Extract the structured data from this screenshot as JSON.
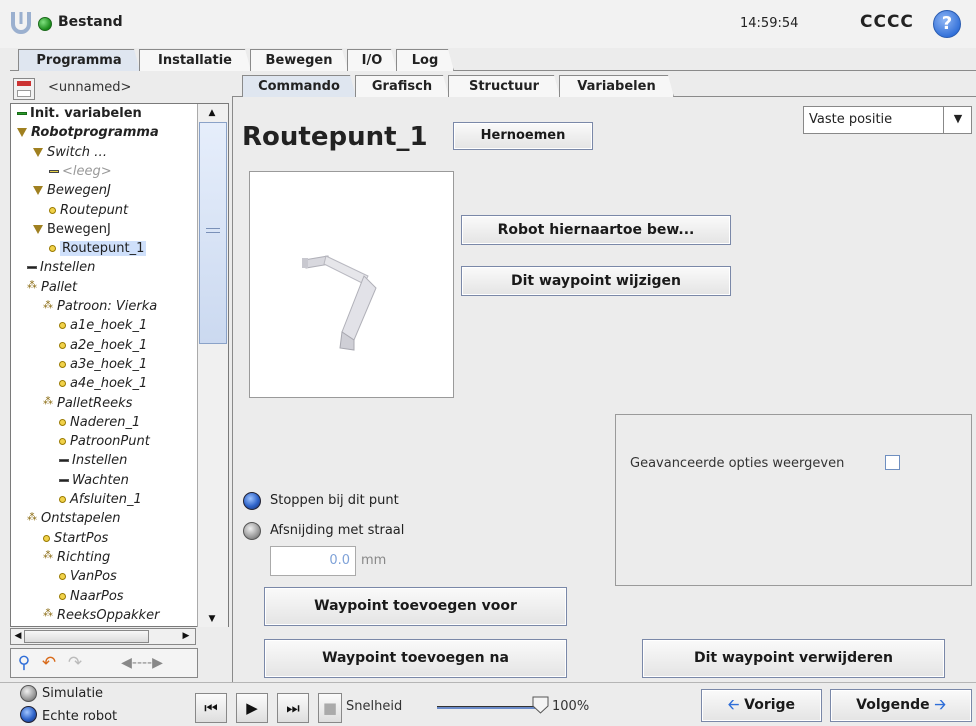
{
  "header": {
    "title": "Bestand",
    "clock": "14:59:54",
    "user": "CCCC",
    "help_icon": "?"
  },
  "main_tabs": [
    "Programma",
    "Installatie",
    "Bewegen",
    "I/O",
    "Log"
  ],
  "program_name": "<unnamed>",
  "sub_tabs": [
    "Commando",
    "Grafisch",
    "Structuur",
    "Variabelen"
  ],
  "tree": [
    {
      "label": "Init. variabelen",
      "icon": "green-bar-icon"
    },
    {
      "label": "Robotprogramma",
      "icon": "triangle-icon"
    },
    {
      "label": "Switch …",
      "icon": "triangle-icon"
    },
    {
      "label": "<leeg>",
      "icon": "yellow-bar-icon"
    },
    {
      "label": "BewegenJ",
      "icon": "triangle-icon"
    },
    {
      "label": "Routepunt",
      "icon": "waypoint-icon"
    },
    {
      "label": "BewegenJ",
      "icon": "triangle-icon"
    },
    {
      "label": "Routepunt_1",
      "icon": "waypoint-icon"
    },
    {
      "label": "Instellen",
      "icon": "bar-icon"
    },
    {
      "label": "Pallet",
      "icon": "pallet-icon"
    },
    {
      "label": "Patroon: Vierka",
      "icon": "pallet-icon"
    },
    {
      "label": "a1e_hoek_1",
      "icon": "waypoint-icon"
    },
    {
      "label": "a2e_hoek_1",
      "icon": "waypoint-icon"
    },
    {
      "label": "a3e_hoek_1",
      "icon": "waypoint-icon"
    },
    {
      "label": "a4e_hoek_1",
      "icon": "waypoint-icon"
    },
    {
      "label": "PalletReeks",
      "icon": "pallet-icon"
    },
    {
      "label": "Naderen_1",
      "icon": "waypoint-icon"
    },
    {
      "label": "PatroonPunt",
      "icon": "waypoint-icon"
    },
    {
      "label": "Instellen",
      "icon": "bar-icon"
    },
    {
      "label": "Wachten",
      "icon": "bar-icon"
    },
    {
      "label": "Afsluiten_1",
      "icon": "waypoint-icon"
    },
    {
      "label": "Ontstapelen",
      "icon": "pallet-icon"
    },
    {
      "label": "StartPos",
      "icon": "waypoint-icon"
    },
    {
      "label": "Richting",
      "icon": "pallet-icon"
    },
    {
      "label": "VanPos",
      "icon": "waypoint-icon"
    },
    {
      "label": "NaarPos",
      "icon": "waypoint-icon"
    },
    {
      "label": "ReeksOppakker",
      "icon": "pallet-icon"
    }
  ],
  "command": {
    "waypoint_name": "Routepunt_1",
    "rename_label": "Hernoemen",
    "position_type": "Vaste positie",
    "move_here_label": "Robot hiernaartoe bew...",
    "change_waypoint_label": "Dit waypoint wijzigen",
    "advanced_label": "Geavanceerde opties weergeven",
    "stop_label": "Stoppen bij dit punt",
    "blend_label": "Afsnijding met straal",
    "blend_value": "0.0",
    "blend_unit": "mm",
    "add_before_label": "Waypoint toevoegen voor",
    "add_after_label": "Waypoint toevoegen na",
    "delete_label": "Dit waypoint verwijderen"
  },
  "footer": {
    "sim_label": "Simulatie",
    "real_label": "Echte robot",
    "speed_label": "Snelheid",
    "speed_value": "100%",
    "speed_fraction": 1.0,
    "prev_label": "Vorige",
    "next_label": "Volgende"
  },
  "colors": {
    "accent": "#2f6ed8",
    "status_ok": "#1a8a1a",
    "waypoint": "#f1d24a"
  }
}
